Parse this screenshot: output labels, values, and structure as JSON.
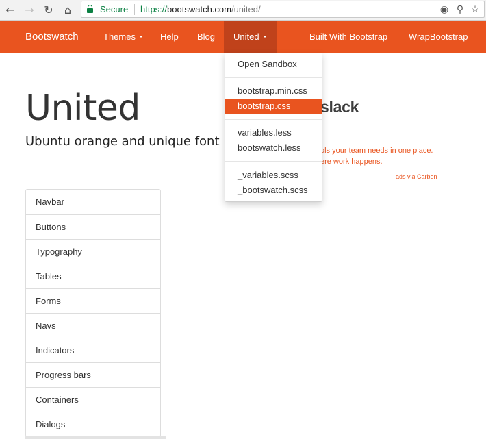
{
  "browser": {
    "secure_label": "Secure",
    "url_scheme": "https://",
    "url_host": "bootswatch.com",
    "url_path": "/united/",
    "icons": [
      "back-arrow-icon",
      "forward-arrow-icon",
      "reload-icon",
      "home-icon",
      "lock-icon",
      "blocked-content-icon",
      "zoom-icon",
      "bookmark-star-icon"
    ]
  },
  "navbar": {
    "brand": "Bootswatch",
    "items": [
      {
        "label": "Themes",
        "dropdown": true
      },
      {
        "label": "Help"
      },
      {
        "label": "Blog"
      },
      {
        "label": "United",
        "dropdown": true,
        "active": true
      },
      {
        "label": "Built With Bootstrap"
      },
      {
        "label": "WrapBootstrap"
      }
    ],
    "color": "#e9541f",
    "active_color": "#c0421b"
  },
  "dropdown": {
    "items": [
      {
        "label": "Open Sandbox"
      },
      {
        "label": "bootstrap.min.css"
      },
      {
        "label": "bootstrap.css",
        "selected": true
      },
      {
        "label": "variables.less"
      },
      {
        "label": "bootswatch.less"
      },
      {
        "label": "_variables.scss"
      },
      {
        "label": "_bootswatch.scss"
      }
    ]
  },
  "header": {
    "title": "United",
    "subtitle": "Ubuntu orange and unique font"
  },
  "ad": {
    "logo_text": "slack",
    "line1": "ols your team needs in one place.",
    "line2": "ere work happens.",
    "via": "ads via Carbon"
  },
  "sections": [
    "Navbar",
    "Buttons",
    "Typography",
    "Tables",
    "Forms",
    "Navs",
    "Indicators",
    "Progress bars",
    "Containers",
    "Dialogs"
  ]
}
